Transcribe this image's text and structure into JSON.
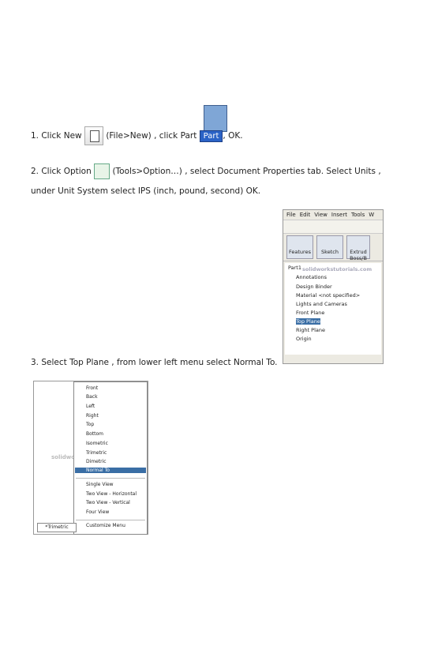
{
  "step1": {
    "prefix": "1. Click New",
    "middle": "(File>New) , click Part",
    "suffix": ", OK.",
    "part_badge": "Part"
  },
  "step2": {
    "prefix": "2. Click Option",
    "line1_rest": "(Tools>Option…) , select Document Properties tab. Select Units ,",
    "line2": "under Unit System select IPS (inch, pound, second) OK."
  },
  "step3": {
    "text": "3. Select Top Plane , from lower left menu select Normal To."
  },
  "sw_panel": {
    "menus": [
      "File",
      "Edit",
      "View",
      "Insert",
      "Tools",
      "W"
    ],
    "tabs": [
      "Features",
      "Sketch",
      "Extrud Boss/B"
    ],
    "watermark": "solidworkstutorials.com",
    "tree": [
      "Part1",
      "Annotations",
      "Design Binder",
      "Material <not specified>",
      "Lights and Cameras",
      "Front Plane",
      "Top Plane",
      "Right Plane",
      "Origin"
    ]
  },
  "view_menu": {
    "items": [
      "Front",
      "Back",
      "Left",
      "Right",
      "Top",
      "Bottom",
      "Isometric",
      "Trimetric",
      "Dimetric",
      "Normal To"
    ],
    "items2": [
      "Single View",
      "Two View - Horizontal",
      "Two View - Vertical",
      "Four View"
    ],
    "customize": "Customize Menu",
    "watermark": "solidworkstutorials.com",
    "view_label": "*Trimetric"
  }
}
